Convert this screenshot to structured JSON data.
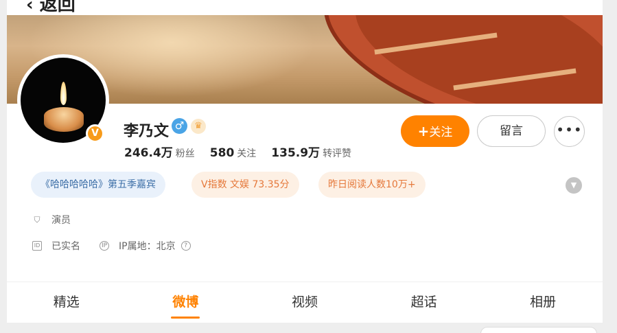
{
  "header": {
    "back_label": "‹ 返回"
  },
  "profile": {
    "name": "李乃文",
    "gender_icon": "male-icon",
    "member_icon": "crown-icon",
    "verified_badge": "V",
    "stats": [
      {
        "value": "246.4万",
        "label": "粉丝"
      },
      {
        "value": "580",
        "label": "关注"
      },
      {
        "value": "135.9万",
        "label": "转评赞"
      }
    ]
  },
  "actions": {
    "follow_plus": "+",
    "follow_label": "关注",
    "message_label": "留言",
    "more_label": "•••"
  },
  "tags": [
    "《哈哈哈哈哈》第五季嘉宾",
    "V指数 文娱 73.35分",
    "昨日阅读人数10万+"
  ],
  "info": {
    "occupation": "演员",
    "verified_name": "已实名",
    "ip_location": "IP属地：北京"
  },
  "tabs": [
    "精选",
    "微博",
    "视频",
    "超话",
    "相册"
  ],
  "active_tab": "微博",
  "colors": {
    "accent": "#ff8200",
    "link_blue": "#3d6fa7",
    "tag_orange": "#e5783a"
  }
}
